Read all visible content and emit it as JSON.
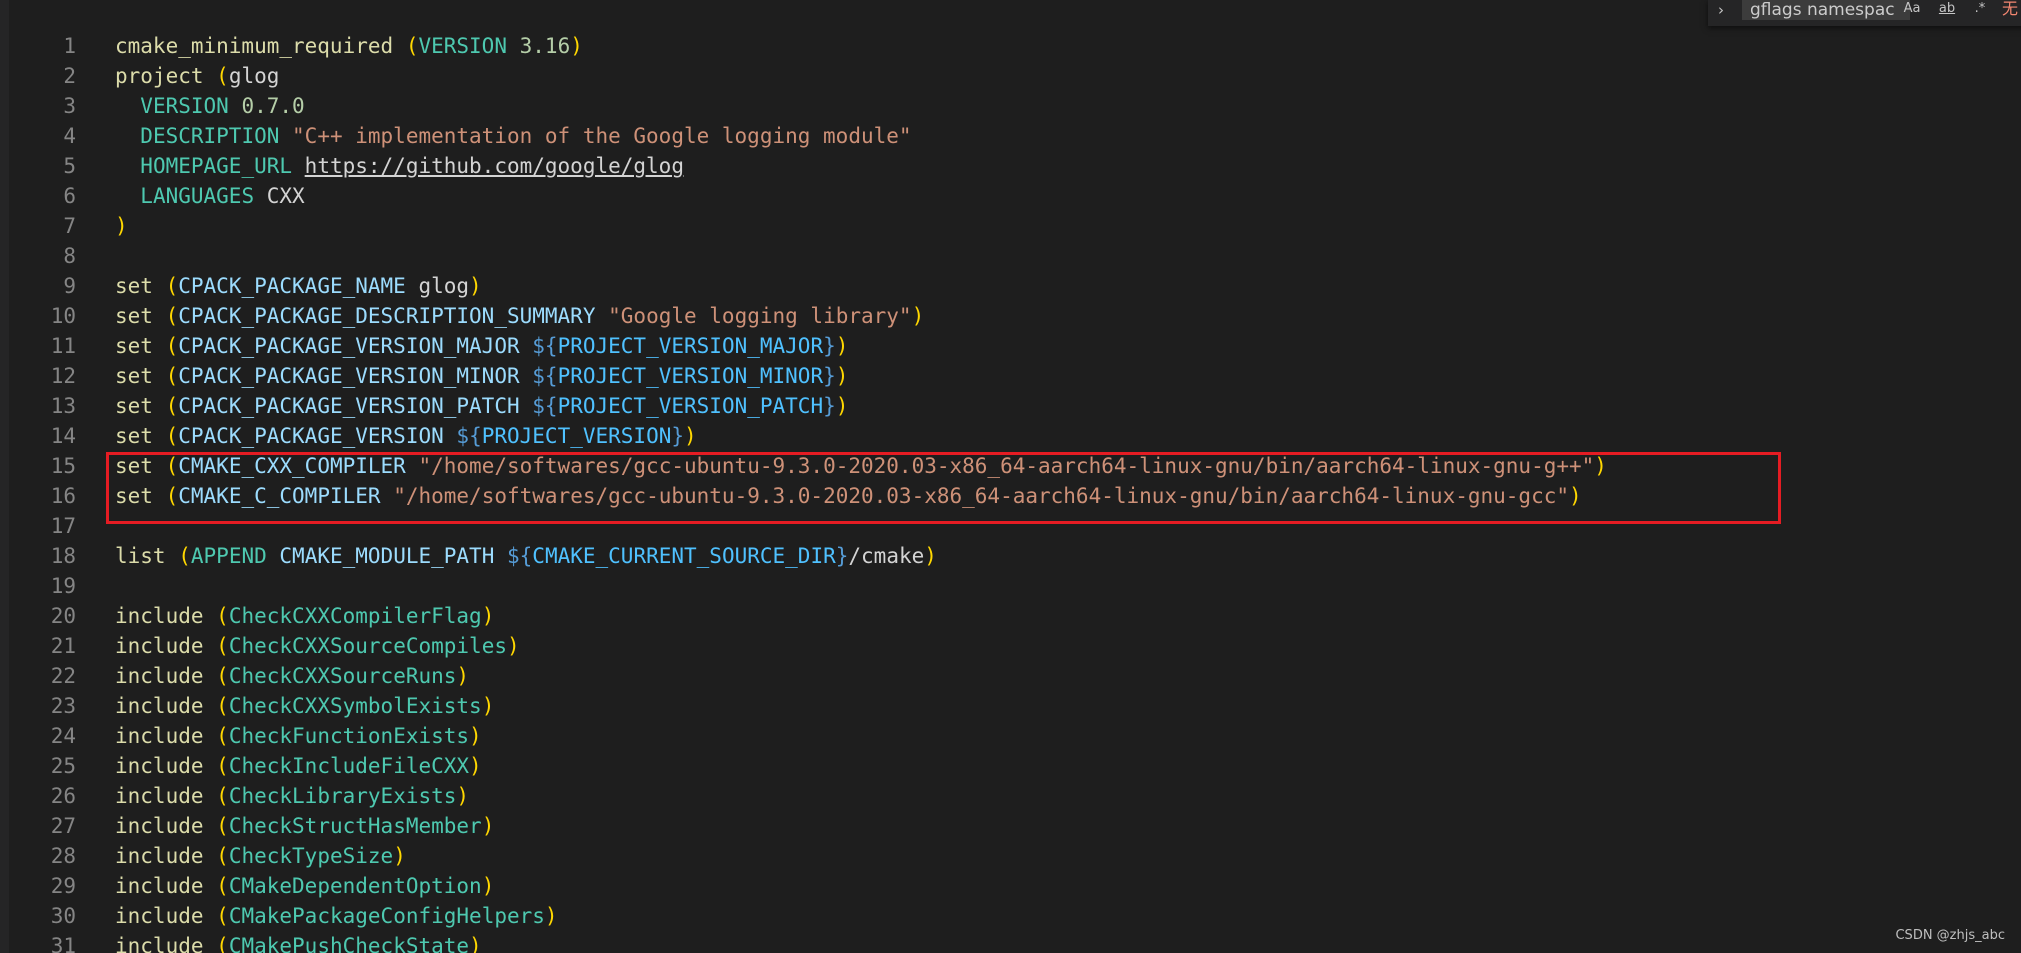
{
  "find_widget": {
    "toggle_icon": "chevron-right-icon",
    "query": "gflags namespac",
    "match_case_label": "Aa",
    "whole_word_label": "ab",
    "regex_label": ".*",
    "result": "无"
  },
  "watermark": "CSDN @zhjs_abc",
  "highlight_color": "#e51c23",
  "lines": [
    {
      "n": "1",
      "tokens": [
        {
          "c": "fn",
          "t": "cmake_minimum_required"
        },
        {
          "c": "plain",
          "t": " "
        },
        {
          "c": "p1",
          "t": "("
        },
        {
          "c": "kw",
          "t": "VERSION"
        },
        {
          "c": "plain",
          "t": " "
        },
        {
          "c": "num",
          "t": "3.16"
        },
        {
          "c": "p1",
          "t": ")"
        }
      ]
    },
    {
      "n": "2",
      "tokens": [
        {
          "c": "fn",
          "t": "project"
        },
        {
          "c": "plain",
          "t": " "
        },
        {
          "c": "p1",
          "t": "("
        },
        {
          "c": "plain",
          "t": "glog"
        }
      ]
    },
    {
      "n": "3",
      "tokens": [
        {
          "c": "guide",
          "t": "  "
        },
        {
          "c": "kw",
          "t": "VERSION"
        },
        {
          "c": "plain",
          "t": " "
        },
        {
          "c": "num",
          "t": "0.7.0"
        }
      ]
    },
    {
      "n": "4",
      "tokens": [
        {
          "c": "guide",
          "t": "  "
        },
        {
          "c": "kw",
          "t": "DESCRIPTION"
        },
        {
          "c": "plain",
          "t": " "
        },
        {
          "c": "str",
          "t": "\"C++ implementation of the Google logging module\""
        }
      ]
    },
    {
      "n": "5",
      "tokens": [
        {
          "c": "guide",
          "t": "  "
        },
        {
          "c": "kw",
          "t": "HOMEPAGE_URL"
        },
        {
          "c": "plain",
          "t": " "
        },
        {
          "c": "url",
          "t": "https://github.com/google/glog"
        }
      ]
    },
    {
      "n": "6",
      "tokens": [
        {
          "c": "guide",
          "t": "  "
        },
        {
          "c": "kw",
          "t": "LANGUAGES"
        },
        {
          "c": "plain",
          "t": " CXX"
        }
      ]
    },
    {
      "n": "7",
      "tokens": [
        {
          "c": "p1",
          "t": ")"
        }
      ]
    },
    {
      "n": "8",
      "tokens": []
    },
    {
      "n": "9",
      "tokens": [
        {
          "c": "fn",
          "t": "set"
        },
        {
          "c": "plain",
          "t": " "
        },
        {
          "c": "p1",
          "t": "("
        },
        {
          "c": "var",
          "t": "CPACK_PACKAGE_NAME"
        },
        {
          "c": "plain",
          "t": " glog"
        },
        {
          "c": "p1",
          "t": ")"
        }
      ]
    },
    {
      "n": "10",
      "tokens": [
        {
          "c": "fn",
          "t": "set"
        },
        {
          "c": "plain",
          "t": " "
        },
        {
          "c": "p1",
          "t": "("
        },
        {
          "c": "var",
          "t": "CPACK_PACKAGE_DESCRIPTION_SUMMARY"
        },
        {
          "c": "plain",
          "t": " "
        },
        {
          "c": "str",
          "t": "\"Google logging library\""
        },
        {
          "c": "p1",
          "t": ")"
        }
      ]
    },
    {
      "n": "11",
      "tokens": [
        {
          "c": "fn",
          "t": "set"
        },
        {
          "c": "plain",
          "t": " "
        },
        {
          "c": "p1",
          "t": "("
        },
        {
          "c": "var",
          "t": "CPACK_PACKAGE_VERSION_MAJOR"
        },
        {
          "c": "plain",
          "t": " "
        },
        {
          "c": "dlr",
          "t": "${"
        },
        {
          "c": "dvar",
          "t": "PROJECT_VERSION_MAJOR"
        },
        {
          "c": "dlr",
          "t": "}"
        },
        {
          "c": "p1",
          "t": ")"
        }
      ]
    },
    {
      "n": "12",
      "tokens": [
        {
          "c": "fn",
          "t": "set"
        },
        {
          "c": "plain",
          "t": " "
        },
        {
          "c": "p1",
          "t": "("
        },
        {
          "c": "var",
          "t": "CPACK_PACKAGE_VERSION_MINOR"
        },
        {
          "c": "plain",
          "t": " "
        },
        {
          "c": "dlr",
          "t": "${"
        },
        {
          "c": "dvar",
          "t": "PROJECT_VERSION_MINOR"
        },
        {
          "c": "dlr",
          "t": "}"
        },
        {
          "c": "p1",
          "t": ")"
        }
      ]
    },
    {
      "n": "13",
      "tokens": [
        {
          "c": "fn",
          "t": "set"
        },
        {
          "c": "plain",
          "t": " "
        },
        {
          "c": "p1",
          "t": "("
        },
        {
          "c": "var",
          "t": "CPACK_PACKAGE_VERSION_PATCH"
        },
        {
          "c": "plain",
          "t": " "
        },
        {
          "c": "dlr",
          "t": "${"
        },
        {
          "c": "dvar",
          "t": "PROJECT_VERSION_PATCH"
        },
        {
          "c": "dlr",
          "t": "}"
        },
        {
          "c": "p1",
          "t": ")"
        }
      ]
    },
    {
      "n": "14",
      "tokens": [
        {
          "c": "fn",
          "t": "set"
        },
        {
          "c": "plain",
          "t": " "
        },
        {
          "c": "p1",
          "t": "("
        },
        {
          "c": "var",
          "t": "CPACK_PACKAGE_VERSION"
        },
        {
          "c": "plain",
          "t": " "
        },
        {
          "c": "dlr",
          "t": "${"
        },
        {
          "c": "dvar",
          "t": "PROJECT_VERSION"
        },
        {
          "c": "dlr",
          "t": "}"
        },
        {
          "c": "p1",
          "t": ")"
        }
      ]
    },
    {
      "n": "15",
      "tokens": [
        {
          "c": "fn",
          "t": "set"
        },
        {
          "c": "plain",
          "t": " "
        },
        {
          "c": "p1",
          "t": "("
        },
        {
          "c": "var",
          "t": "CMAKE_CXX_COMPILER"
        },
        {
          "c": "plain",
          "t": " "
        },
        {
          "c": "str",
          "t": "\"/home/softwares/gcc-ubuntu-9.3.0-2020.03-x86_64-aarch64-linux-gnu/bin/aarch64-linux-gnu-g++\""
        },
        {
          "c": "p1",
          "t": ")"
        }
      ]
    },
    {
      "n": "16",
      "tokens": [
        {
          "c": "fn",
          "t": "set"
        },
        {
          "c": "plain",
          "t": " "
        },
        {
          "c": "p1",
          "t": "("
        },
        {
          "c": "var",
          "t": "CMAKE_C_COMPILER"
        },
        {
          "c": "plain",
          "t": " "
        },
        {
          "c": "str",
          "t": "\"/home/softwares/gcc-ubuntu-9.3.0-2020.03-x86_64-aarch64-linux-gnu/bin/aarch64-linux-gnu-gcc\""
        },
        {
          "c": "p1",
          "t": ")"
        }
      ]
    },
    {
      "n": "17",
      "tokens": []
    },
    {
      "n": "18",
      "tokens": [
        {
          "c": "fn",
          "t": "list"
        },
        {
          "c": "plain",
          "t": " "
        },
        {
          "c": "p1",
          "t": "("
        },
        {
          "c": "kw",
          "t": "APPEND"
        },
        {
          "c": "plain",
          "t": " "
        },
        {
          "c": "var",
          "t": "CMAKE_MODULE_PATH"
        },
        {
          "c": "plain",
          "t": " "
        },
        {
          "c": "dlr",
          "t": "${"
        },
        {
          "c": "dvar",
          "t": "CMAKE_CURRENT_SOURCE_DIR"
        },
        {
          "c": "dlr",
          "t": "}"
        },
        {
          "c": "plain",
          "t": "/cmake"
        },
        {
          "c": "p1",
          "t": ")"
        }
      ]
    },
    {
      "n": "19",
      "tokens": []
    },
    {
      "n": "20",
      "tokens": [
        {
          "c": "fn",
          "t": "include"
        },
        {
          "c": "plain",
          "t": " "
        },
        {
          "c": "p1",
          "t": "("
        },
        {
          "c": "kw",
          "t": "CheckCXXCompilerFlag"
        },
        {
          "c": "p1",
          "t": ")"
        }
      ]
    },
    {
      "n": "21",
      "tokens": [
        {
          "c": "fn",
          "t": "include"
        },
        {
          "c": "plain",
          "t": " "
        },
        {
          "c": "p1",
          "t": "("
        },
        {
          "c": "kw",
          "t": "CheckCXXSourceCompiles"
        },
        {
          "c": "p1",
          "t": ")"
        }
      ]
    },
    {
      "n": "22",
      "tokens": [
        {
          "c": "fn",
          "t": "include"
        },
        {
          "c": "plain",
          "t": " "
        },
        {
          "c": "p1",
          "t": "("
        },
        {
          "c": "kw",
          "t": "CheckCXXSourceRuns"
        },
        {
          "c": "p1",
          "t": ")"
        }
      ]
    },
    {
      "n": "23",
      "tokens": [
        {
          "c": "fn",
          "t": "include"
        },
        {
          "c": "plain",
          "t": " "
        },
        {
          "c": "p1",
          "t": "("
        },
        {
          "c": "kw",
          "t": "CheckCXXSymbolExists"
        },
        {
          "c": "p1",
          "t": ")"
        }
      ]
    },
    {
      "n": "24",
      "tokens": [
        {
          "c": "fn",
          "t": "include"
        },
        {
          "c": "plain",
          "t": " "
        },
        {
          "c": "p1",
          "t": "("
        },
        {
          "c": "kw",
          "t": "CheckFunctionExists"
        },
        {
          "c": "p1",
          "t": ")"
        }
      ]
    },
    {
      "n": "25",
      "tokens": [
        {
          "c": "fn",
          "t": "include"
        },
        {
          "c": "plain",
          "t": " "
        },
        {
          "c": "p1",
          "t": "("
        },
        {
          "c": "kw",
          "t": "CheckIncludeFileCXX"
        },
        {
          "c": "p1",
          "t": ")"
        }
      ]
    },
    {
      "n": "26",
      "tokens": [
        {
          "c": "fn",
          "t": "include"
        },
        {
          "c": "plain",
          "t": " "
        },
        {
          "c": "p1",
          "t": "("
        },
        {
          "c": "kw",
          "t": "CheckLibraryExists"
        },
        {
          "c": "p1",
          "t": ")"
        }
      ]
    },
    {
      "n": "27",
      "tokens": [
        {
          "c": "fn",
          "t": "include"
        },
        {
          "c": "plain",
          "t": " "
        },
        {
          "c": "p1",
          "t": "("
        },
        {
          "c": "kw",
          "t": "CheckStructHasMember"
        },
        {
          "c": "p1",
          "t": ")"
        }
      ]
    },
    {
      "n": "28",
      "tokens": [
        {
          "c": "fn",
          "t": "include"
        },
        {
          "c": "plain",
          "t": " "
        },
        {
          "c": "p1",
          "t": "("
        },
        {
          "c": "kw",
          "t": "CheckTypeSize"
        },
        {
          "c": "p1",
          "t": ")"
        }
      ]
    },
    {
      "n": "29",
      "tokens": [
        {
          "c": "fn",
          "t": "include"
        },
        {
          "c": "plain",
          "t": " "
        },
        {
          "c": "p1",
          "t": "("
        },
        {
          "c": "kw",
          "t": "CMakeDependentOption"
        },
        {
          "c": "p1",
          "t": ")"
        }
      ]
    },
    {
      "n": "30",
      "tokens": [
        {
          "c": "fn",
          "t": "include"
        },
        {
          "c": "plain",
          "t": " "
        },
        {
          "c": "p1",
          "t": "("
        },
        {
          "c": "kw",
          "t": "CMakePackageConfigHelpers"
        },
        {
          "c": "p1",
          "t": ")"
        }
      ]
    },
    {
      "n": "31",
      "tokens": [
        {
          "c": "fn",
          "t": "include"
        },
        {
          "c": "plain",
          "t": " "
        },
        {
          "c": "p1",
          "t": "("
        },
        {
          "c": "kw",
          "t": "CMakePushCheckState"
        },
        {
          "c": "p1",
          "t": ")"
        }
      ]
    }
  ]
}
